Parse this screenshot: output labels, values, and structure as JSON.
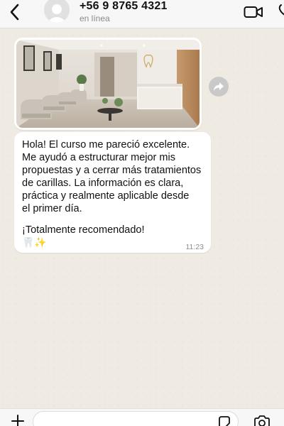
{
  "header": {
    "contact_name": "+56 9 8765 4321",
    "status": "en línea",
    "icons": [
      "chevron-left-icon",
      "avatar-icon",
      "video-camera-icon",
      "phone-icon"
    ]
  },
  "chat": {
    "image_message": {
      "forward_icon": "share-arrow-icon"
    },
    "text_message": {
      "lines": [
        "Hola! El curso me pareció excelente.",
        "Me ayudó a estructurar mejor mis",
        "propuestas y a cerrar más tratamientos",
        "de carillas. La información es clara,",
        "práctica y realmente aplicable desde",
        "el primer día.",
        "¡Totalmente recomendado!"
      ],
      "emojis": "🦷✨",
      "time": "11:23"
    }
  },
  "input_bar": {
    "message_value": "",
    "icons": [
      "plus-icon",
      "sticker-icon",
      "camera-icon"
    ]
  },
  "colors": {
    "chat_background": "#efeae2",
    "bubble": "#ffffff",
    "header": "#f7f7f7",
    "time_text": "#8c8c8c"
  }
}
